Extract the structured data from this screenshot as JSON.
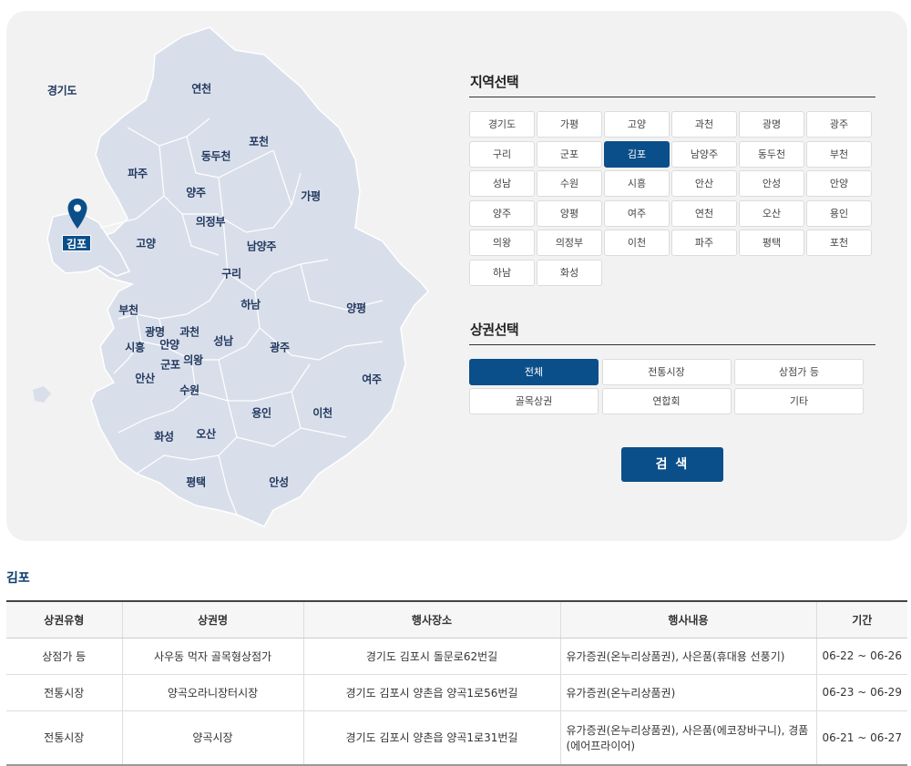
{
  "map": {
    "labels": {
      "gyeonggi": "경기도",
      "yeoncheon": "연천",
      "pocheon": "포천",
      "dongducheon": "동두천",
      "paju": "파주",
      "yangju": "양주",
      "gapyeong": "가평",
      "uijeongbu": "의정부",
      "goyang": "고양",
      "namyangju": "남양주",
      "guri": "구리",
      "hanam": "하남",
      "yangpyeong": "양평",
      "bucheon": "부천",
      "gwangmyeong": "광명",
      "gwacheon": "과천",
      "siheung": "시흥",
      "anyang": "안양",
      "seongnam": "성남",
      "gwangju": "광주",
      "gunpo": "군포",
      "uiwang": "의왕",
      "ansan": "안산",
      "suwon": "수원",
      "yeoju": "여주",
      "yongin": "용인",
      "icheon": "이천",
      "hwaseong": "화성",
      "osan": "오산",
      "pyeongtaek": "평택",
      "anseong": "안성",
      "gimpo": "김포"
    },
    "selected_marker": "map-pin-icon"
  },
  "region_select": {
    "title": "지역선택",
    "selected": "김포",
    "options": [
      "경기도",
      "가평",
      "고양",
      "과천",
      "광명",
      "광주",
      "구리",
      "군포",
      "김포",
      "남양주",
      "동두천",
      "부천",
      "성남",
      "수원",
      "시흥",
      "안산",
      "안성",
      "안양",
      "양주",
      "양평",
      "여주",
      "연천",
      "오산",
      "용인",
      "의왕",
      "의정부",
      "이천",
      "파주",
      "평택",
      "포천",
      "하남",
      "화성"
    ]
  },
  "category_select": {
    "title": "상권선택",
    "selected": "전체",
    "options": [
      "전체",
      "전통시장",
      "상점가 등",
      "골목상권",
      "연합회",
      "기타"
    ]
  },
  "search_button": "검 색",
  "results": {
    "title": "김포",
    "columns": [
      "상권유형",
      "상권명",
      "행사장소",
      "행사내용",
      "기간"
    ],
    "rows": [
      [
        "상점가 등",
        "사우동 먹자 골목형상점가",
        "경기도 김포시 돌문로62번길",
        "유가증권(온누리상품권), 사은품(휴대용 선풍기)",
        "06-22 ~ 06-26"
      ],
      [
        "전통시장",
        "양곡오라니장터시장",
        "경기도 김포시 양촌읍 양곡1로56번길",
        "유가증권(온누리상품권)",
        "06-23 ~ 06-29"
      ],
      [
        "전통시장",
        "양곡시장",
        "경기도 김포시 양촌읍 양곡1로31번길",
        "유가증권(온누리상품권), 사은품(에코장바구니), 경품(에어프라이어)",
        "06-21 ~ 06-27"
      ]
    ]
  },
  "colors": {
    "accent": "#0b4f8a",
    "map_fill": "#d8dee9",
    "panel_bg": "#f2f2f2"
  }
}
